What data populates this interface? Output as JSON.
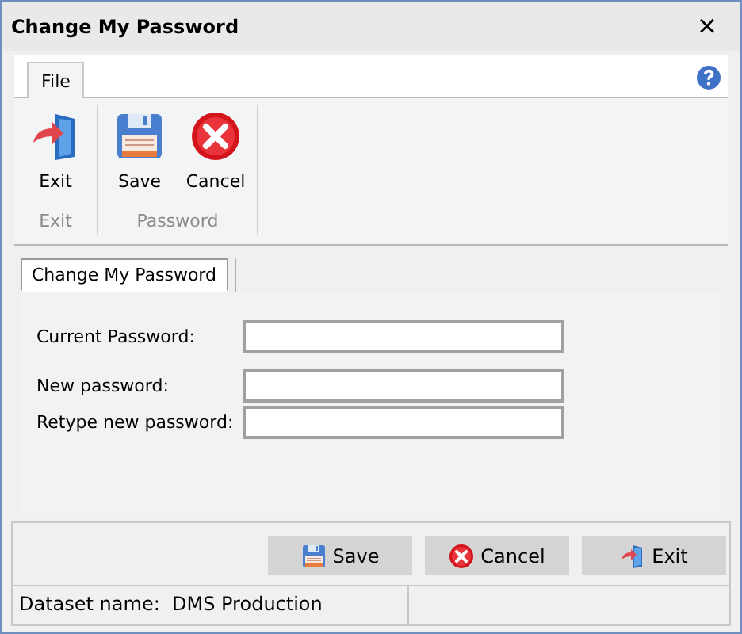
{
  "window": {
    "title": "Change My Password",
    "close": "×"
  },
  "ribbon": {
    "tabs": [
      {
        "label": "File",
        "selected": true
      }
    ],
    "groups": [
      {
        "label": "Exit",
        "buttons": [
          {
            "label": "Exit",
            "kind": "exit"
          }
        ]
      },
      {
        "label": "Password",
        "buttons": [
          {
            "label": "Save",
            "kind": "save"
          },
          {
            "label": "Cancel",
            "kind": "cancel"
          }
        ]
      }
    ]
  },
  "page_tabs": [
    {
      "label": "Change My Password",
      "selected": true
    }
  ],
  "fields": [
    {
      "label": "Current Password:"
    },
    {
      "label": "New password:"
    },
    {
      "label": "Retype new password:"
    }
  ],
  "buttons": [
    {
      "label": "Save",
      "kind": "save"
    },
    {
      "label": "Cancel",
      "kind": "cancel"
    },
    {
      "label": "Exit",
      "kind": "exit"
    }
  ],
  "status_bar": {
    "text": "Dataset name:  DMS Production"
  }
}
